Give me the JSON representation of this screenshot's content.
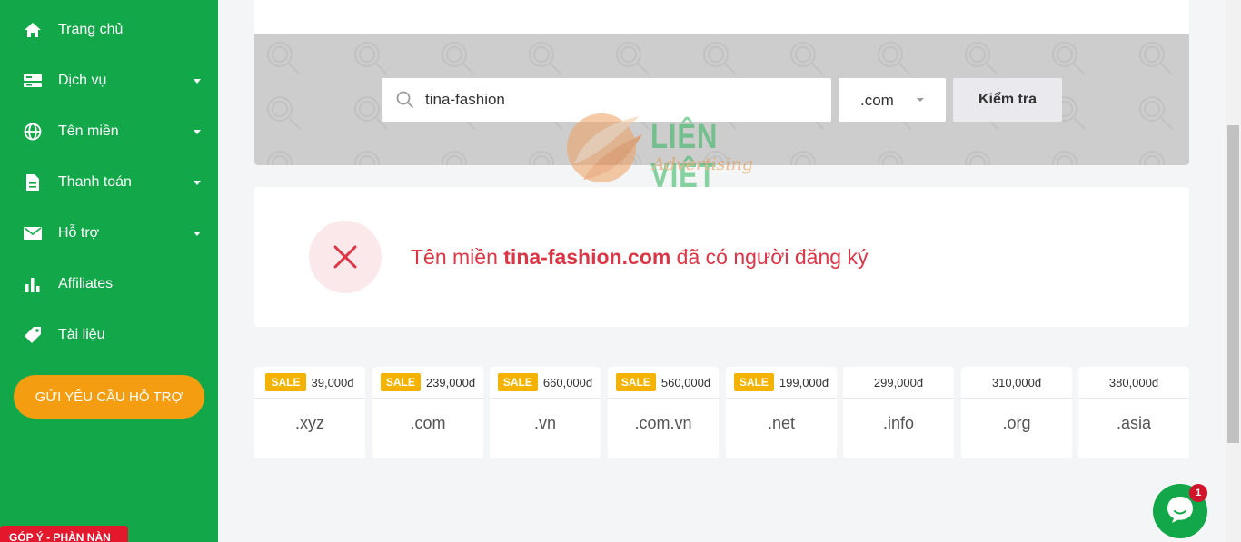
{
  "sidebar": {
    "items": [
      {
        "label": "Trang chủ",
        "icon": "home-icon",
        "has_submenu": false
      },
      {
        "label": "Dịch vụ",
        "icon": "server-icon",
        "has_submenu": true
      },
      {
        "label": "Tên miền",
        "icon": "globe-icon",
        "has_submenu": true
      },
      {
        "label": "Thanh toán",
        "icon": "invoice-icon",
        "has_submenu": true
      },
      {
        "label": "Hỗ trợ",
        "icon": "envelope-icon",
        "has_submenu": true
      },
      {
        "label": "Affiliates",
        "icon": "bar-chart-icon",
        "has_submenu": false
      },
      {
        "label": "Tài liệu",
        "icon": "tag-icon",
        "has_submenu": false
      }
    ],
    "support_button": "GỬI YÊU CẦU HỖ TRỢ",
    "feedback_tab": "GÓP Ý - PHÀN NÀN"
  },
  "search": {
    "query": "tina-fashion",
    "tld_selected": ".com",
    "check_button": "Kiểm tra"
  },
  "watermark": {
    "brand": "LIÊN VIỆT",
    "tagline": "Advertising"
  },
  "result": {
    "prefix": "Tên miền",
    "domain": "tina-fashion.com",
    "suffix": "đã có người đăng ký",
    "status": "taken"
  },
  "price_list": [
    {
      "sale": "SALE",
      "price": "39,000đ",
      "tld": ".xyz"
    },
    {
      "sale": "SALE",
      "price": "239,000đ",
      "tld": ".com"
    },
    {
      "sale": "SALE",
      "price": "660,000đ",
      "tld": ".vn"
    },
    {
      "sale": "SALE",
      "price": "560,000đ",
      "tld": ".com.vn"
    },
    {
      "sale": "SALE",
      "price": "199,000đ",
      "tld": ".net"
    },
    {
      "sale": "",
      "price": "299,000đ",
      "tld": ".info"
    },
    {
      "sale": "",
      "price": "310,000đ",
      "tld": ".org"
    },
    {
      "sale": "",
      "price": "380,000đ",
      "tld": ".asia"
    }
  ],
  "chat": {
    "badge_count": "1"
  },
  "colors": {
    "sidebar_green": "#12a84a",
    "accent_orange": "#f59d10",
    "error_red": "#dc3545",
    "sale_yellow": "#f5b301"
  }
}
